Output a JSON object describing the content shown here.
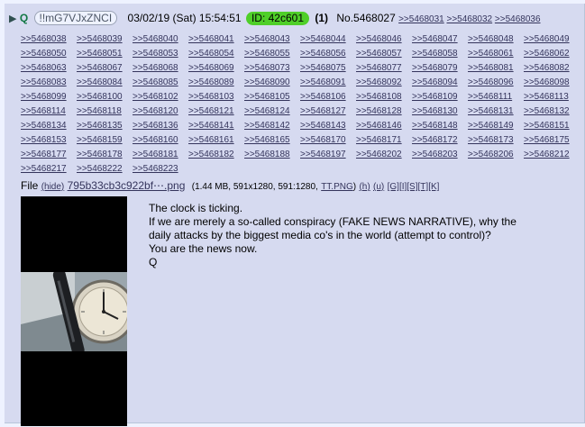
{
  "header": {
    "arrow": "▶",
    "name": "Q",
    "tripcode": "!!mG7VJxZNCI",
    "date": "03/02/19 (Sat) 15:54:51",
    "id_label": "ID: 42c601",
    "post_count": "(1)",
    "post_no": "No.5468027",
    "backlinks_first": [
      ">>5468031",
      ">>5468032",
      ">>5468036"
    ]
  },
  "backlink_rows": [
    [
      ">>5468038",
      ">>5468039",
      ">>5468040",
      ">>5468041",
      ">>5468043",
      ">>5468044",
      ">>5468046",
      ">>5468047",
      ">>5468048",
      ">>5468049"
    ],
    [
      ">>5468050",
      ">>5468051",
      ">>5468053",
      ">>5468054",
      ">>5468055",
      ">>5468056",
      ">>5468057",
      ">>5468058",
      ">>5468061",
      ">>5468062"
    ],
    [
      ">>5468063",
      ">>5468067",
      ">>5468068",
      ">>5468069",
      ">>5468073",
      ">>5468075",
      ">>5468077",
      ">>5468079",
      ">>5468081",
      ">>5468082"
    ],
    [
      ">>5468083",
      ">>5468084",
      ">>5468085",
      ">>5468089",
      ">>5468090",
      ">>5468091",
      ">>5468092",
      ">>5468094",
      ">>5468096",
      ">>5468098"
    ],
    [
      ">>5468099",
      ">>5468100",
      ">>5468102",
      ">>5468103",
      ">>5468105",
      ">>5468106",
      ">>5468108",
      ">>5468109",
      ">>5468111",
      ">>5468113"
    ],
    [
      ">>5468114",
      ">>5468118",
      ">>5468120",
      ">>5468121",
      ">>5468124",
      ">>5468127",
      ">>5468128",
      ">>5468130",
      ">>5468131",
      ">>5468132"
    ],
    [
      ">>5468134",
      ">>5468135",
      ">>5468136",
      ">>5468141",
      ">>5468142",
      ">>5468143",
      ">>5468146",
      ">>5468148",
      ">>5468149",
      ">>5468151"
    ],
    [
      ">>5468153",
      ">>5468159",
      ">>5468160",
      ">>5468161",
      ">>5468165",
      ">>5468170",
      ">>5468171",
      ">>5468172",
      ">>5468173",
      ">>5468175"
    ],
    [
      ">>5468177",
      ">>5468178",
      ">>5468181",
      ">>5468182",
      ">>5468188",
      ">>5468197",
      ">>5468202",
      ">>5468203",
      ">>5468206",
      ">>5468212"
    ],
    [
      ">>5468217",
      ">>5468222",
      ">>5468223"
    ]
  ],
  "file": {
    "label": "File",
    "hide": "(hide)",
    "filename": "795b33cb3c922bf⋯.png",
    "size": "(1.44 MB, 591x1280, 591:1280,",
    "orig_name": "TT.PNG",
    "h": "(h)",
    "u": "(u)",
    "tools": [
      "[G]",
      "[I]",
      "[S]",
      "[T]",
      "[K]"
    ]
  },
  "message": [
    "The clock is ticking.",
    "If we are merely a so-called conspiracy (FAKE NEWS NARRATIVE), why the",
    "daily attacks by the biggest media co's in the world (attempt to control)?",
    "You are the news now.",
    "Q"
  ],
  "colors": {
    "page_bg": "#eef2ff",
    "post_bg": "#d6daf0",
    "link": "#34345c",
    "name": "#117743",
    "id_badge": "#4fcf29"
  }
}
